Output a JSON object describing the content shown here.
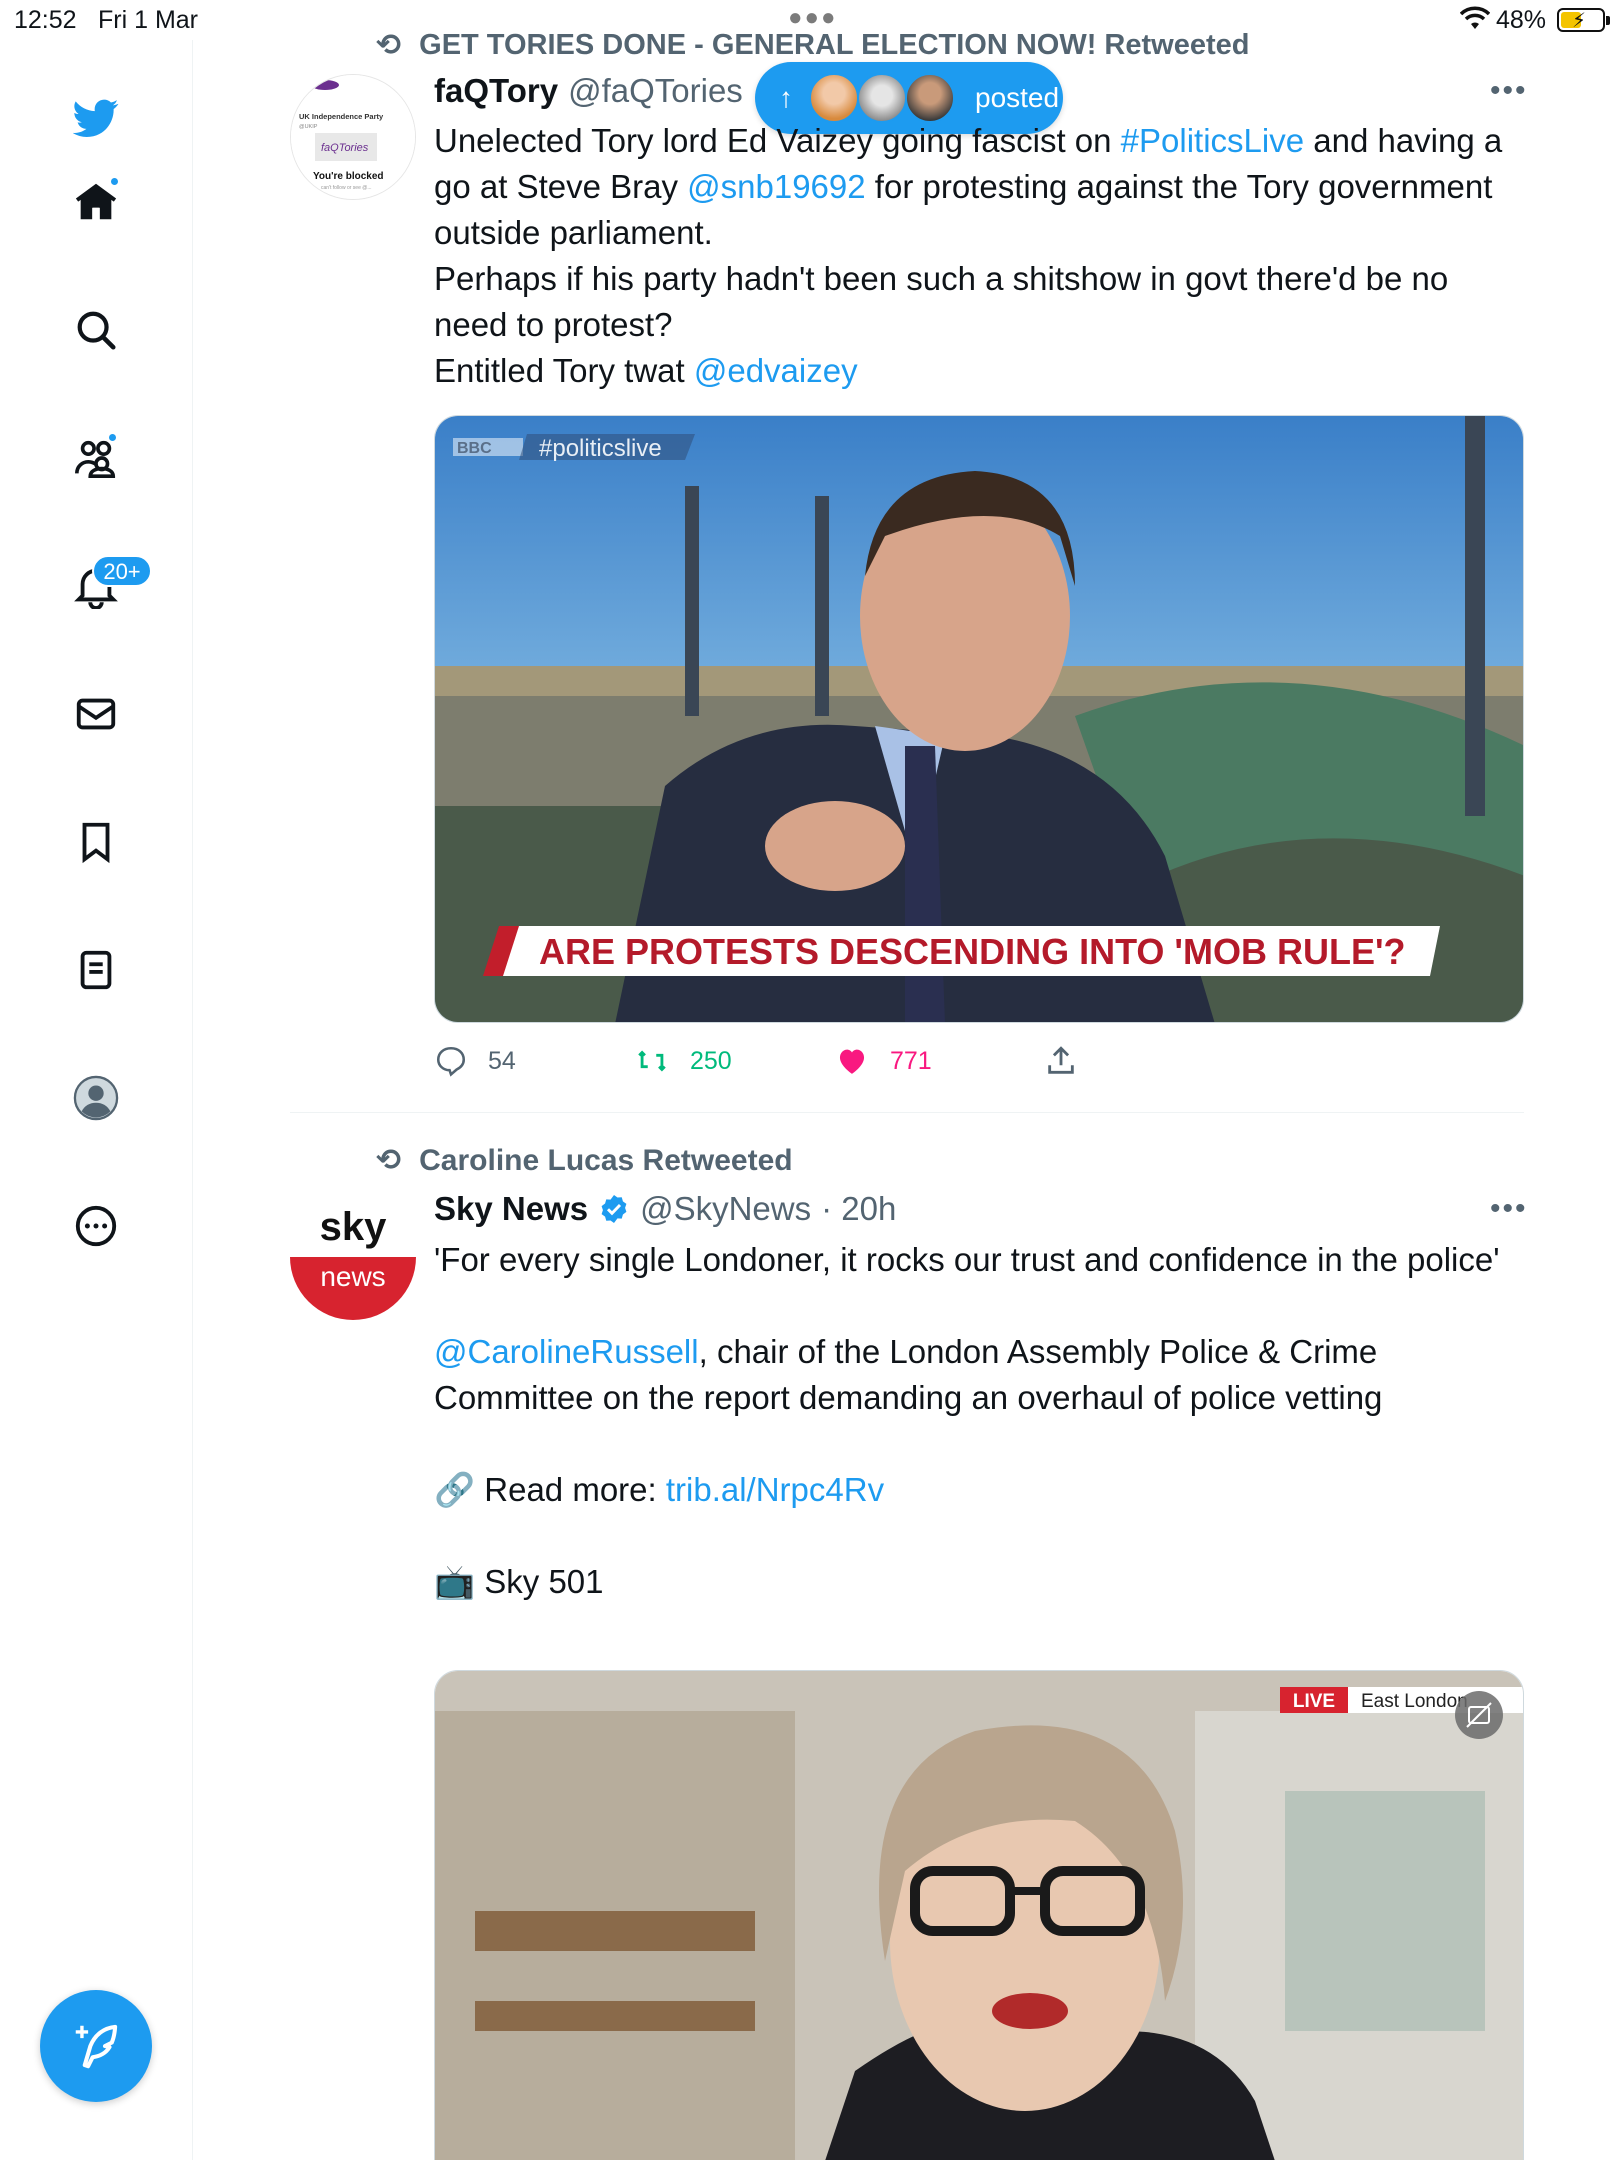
{
  "status_bar": {
    "time": "12:52",
    "date": "Fri 1 Mar",
    "battery": "48%"
  },
  "sidebar": {
    "notifications_badge": "20+"
  },
  "new_posts_pill": {
    "label": "posted"
  },
  "tweet1": {
    "retweeted_by": "GET TORIES DONE - GENERAL ELECTION NOW! Retweeted",
    "avatar_text": {
      "party": "UK Independence Party",
      "handle": "@UKIP",
      "name": "faQTories",
      "blocked": "You're blocked",
      "sub": "can't follow or see @..."
    },
    "name": "faQTory",
    "handle": "@faQTories",
    "text": [
      {
        "t": "Unelected Tory lord Ed Vaizey going fascist on ",
        "link": false
      },
      {
        "t": "#PoliticsLive",
        "link": true
      },
      {
        "t": " and having a go at Steve Bray ",
        "link": false
      },
      {
        "t": "@snb19692",
        "link": true
      },
      {
        "t": " for protesting against the Tory government outside parliament.",
        "link": false
      }
    ],
    "text2": "Perhaps if his party hadn't been such a shitshow in govt there'd be no need to protest?",
    "text3_plain": "Entitled Tory twat ",
    "text3_link": "@edvaizey",
    "media": {
      "logo": "BBC",
      "hashtag": "#politicslive",
      "caption": "ARE PROTESTS DESCENDING INTO 'MOB RULE'?"
    },
    "replies": "54",
    "retweets": "250",
    "likes": "771"
  },
  "tweet2": {
    "retweeted_by": "Caroline Lucas Retweeted",
    "avatar_text": {
      "top": "sky",
      "bottom": "news"
    },
    "name": "Sky News",
    "handle": "@SkyNews",
    "time": "· 20h",
    "line1": "'For every single Londoner, it rocks our trust and confidence in the police'",
    "mention": "@CarolineRussell",
    "line2": ", chair of the London Assembly Police & Crime Committee on the report demanding an overhaul of police vetting",
    "read_more_label": "Read more: ",
    "read_more_link": "trib.al/Nrpc4Rv",
    "channel": "Sky 501",
    "media": {
      "live": "LIVE",
      "location": "East London"
    }
  },
  "colors": {
    "accent": "#1d9bf0",
    "retweet_green": "#00ba7c",
    "like_pink": "#f91880",
    "secondary_text": "#536471"
  }
}
